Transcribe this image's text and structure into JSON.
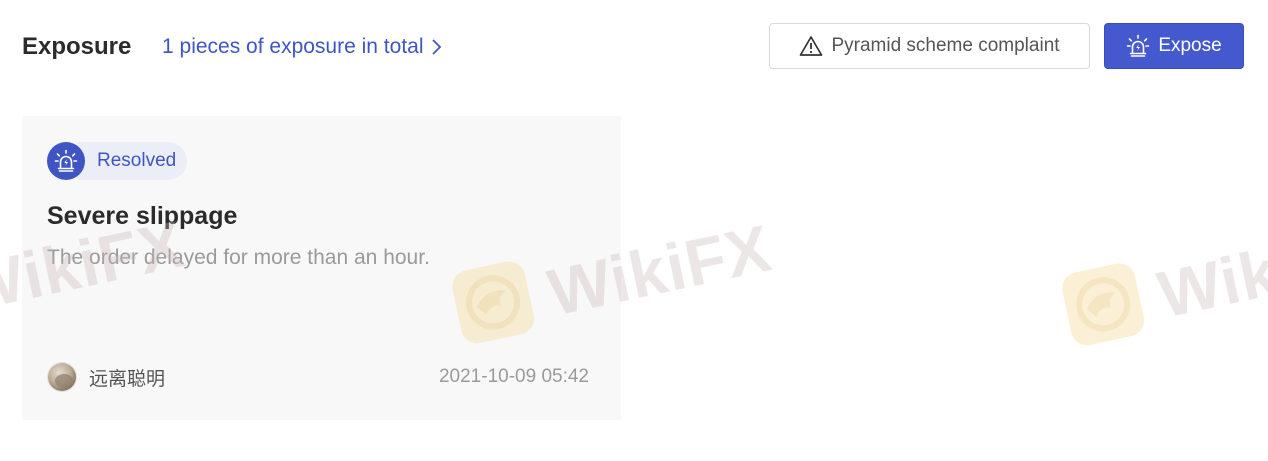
{
  "header": {
    "title": "Exposure",
    "count_link": "1 pieces of exposure in total"
  },
  "actions": {
    "complaint_label": "Pyramid scheme complaint",
    "complaint_icon": "warning-triangle-icon",
    "expose_label": "Expose",
    "expose_icon": "alarm-light-icon"
  },
  "card": {
    "status": "Resolved",
    "status_icon": "alarm-light-icon",
    "title": "Severe slippage",
    "description": "The order delayed for more than an hour.",
    "author": "远离聪明",
    "timestamp": "2021-10-09 05:42"
  },
  "watermark": {
    "text": "WikiFX"
  },
  "colors": {
    "accent": "#3f55c4",
    "button_primary": "#4559cf",
    "card_bg": "#f8f8f8",
    "muted_text": "#9a9a9a"
  }
}
